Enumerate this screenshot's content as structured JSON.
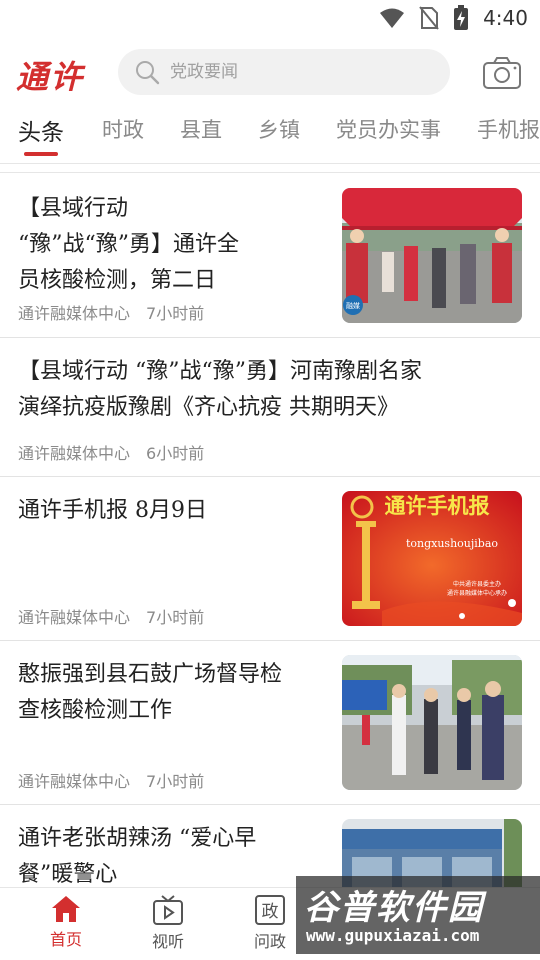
{
  "status_bar": {
    "time": "4:40",
    "icons": [
      "wifi-icon",
      "no-sim-icon",
      "battery-charging-icon"
    ]
  },
  "header": {
    "logo_text": "通许",
    "search_placeholder": "党政要闻",
    "search_icon": "search-icon",
    "camera_icon": "camera-icon"
  },
  "tabs": [
    {
      "label": "头条",
      "active": true
    },
    {
      "label": "时政",
      "active": false
    },
    {
      "label": "县直",
      "active": false
    },
    {
      "label": "乡镇",
      "active": false
    },
    {
      "label": "党员办实事",
      "active": false
    },
    {
      "label": "手机报",
      "active": false
    }
  ],
  "articles": [
    {
      "title_lines": [
        "【县域行动",
        "“豫”战“豫”勇】通许全",
        "员核酸检测，第二日"
      ],
      "source": "通许融媒体中心",
      "time": "7小时前",
      "has_thumb": true,
      "thumb_badge": "融媒"
    },
    {
      "title_lines": [
        "【县域行动 “豫”战“豫”勇】河南豫剧名家",
        "演绎抗疫版豫剧《齐心抗疫 共期明天》"
      ],
      "source": "通许融媒体中心",
      "time": "6小时前",
      "has_thumb": false
    },
    {
      "title_lines": [
        "通许手机报 8月9日"
      ],
      "source": "通许融媒体中心",
      "time": "7小时前",
      "has_thumb": true,
      "thumb_title": "通许手机报",
      "thumb_sub": "tongxushoujibao",
      "thumb_credit_1": "中共通许县委主办",
      "thumb_credit_2": "通许县融媒体中心承办"
    },
    {
      "title_lines": [
        "憨振强到县石鼓广场督导检",
        "查核酸检测工作"
      ],
      "source": "通许融媒体中心",
      "time": "7小时前",
      "has_thumb": true
    },
    {
      "title_lines": [
        "通许老张胡辣汤 “爱心早",
        "餐”暖警心"
      ],
      "has_thumb": true
    }
  ],
  "bottom_nav": [
    {
      "label": "首页",
      "icon": "home-icon",
      "active": true
    },
    {
      "label": "视听",
      "icon": "tv-icon",
      "active": false
    },
    {
      "label": "问政",
      "icon": "politics-icon",
      "active": false
    }
  ],
  "watermark": {
    "text": "谷普软件园",
    "url": "www.gupuxiazai.com"
  },
  "colors": {
    "accent": "#d32f2f",
    "text_primary": "#222222",
    "text_secondary": "#8a8a8a",
    "divider": "#e3e3e3"
  }
}
